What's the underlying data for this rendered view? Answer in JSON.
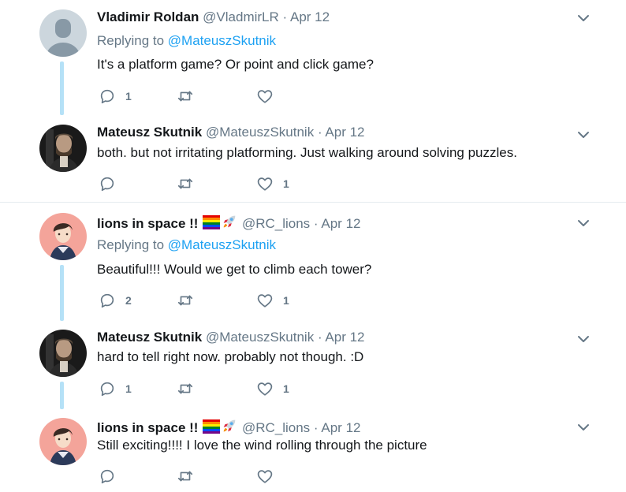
{
  "tweets": [
    {
      "name": "Vladimir Roldan",
      "handle": "@VladmirLR",
      "dot": "·",
      "date": "Apr 12",
      "replying_prefix": "Replying to ",
      "replying_to": "@MateuszSkutnik",
      "text": "It's a platform game? Or point and click game?",
      "reply_count": "1",
      "retweet_count": "",
      "like_count": ""
    },
    {
      "name": "Mateusz Skutnik",
      "handle": "@MateuszSkutnik",
      "dot": "·",
      "date": "Apr 12",
      "text": "both. but not irritating platforming. Just walking around solving puzzles.",
      "reply_count": "",
      "retweet_count": "",
      "like_count": "1"
    },
    {
      "name": "lions in space !!",
      "handle": "@RC_lions",
      "dot": "·",
      "date": "Apr 12",
      "replying_prefix": "Replying to ",
      "replying_to": "@MateuszSkutnik",
      "text": "Beautiful!!! Would we get to climb each tower?",
      "reply_count": "2",
      "retweet_count": "",
      "like_count": "1"
    },
    {
      "name": "Mateusz Skutnik",
      "handle": "@MateuszSkutnik",
      "dot": "·",
      "date": "Apr 12",
      "text": "hard to tell right now. probably  not though. :D",
      "reply_count": "1",
      "retweet_count": "",
      "like_count": "1"
    },
    {
      "name": "lions in space !!",
      "handle": "@RC_lions",
      "dot": "·",
      "date": "Apr 12",
      "text": "Still exciting!!!! I love the wind rolling through the picture",
      "reply_count": "",
      "retweet_count": "",
      "like_count": ""
    }
  ],
  "icons": {
    "reply": "reply-icon",
    "retweet": "retweet-icon",
    "like": "heart-icon",
    "menu": "chevron-down-icon",
    "emoji": [
      "rainbow-flag-icon",
      "rocket-icon"
    ]
  },
  "colors": {
    "text": "#14171a",
    "secondary": "#657786",
    "link": "#1da1f2",
    "thread_line": "#b5e1f7",
    "divider": "#e6ecf0"
  }
}
